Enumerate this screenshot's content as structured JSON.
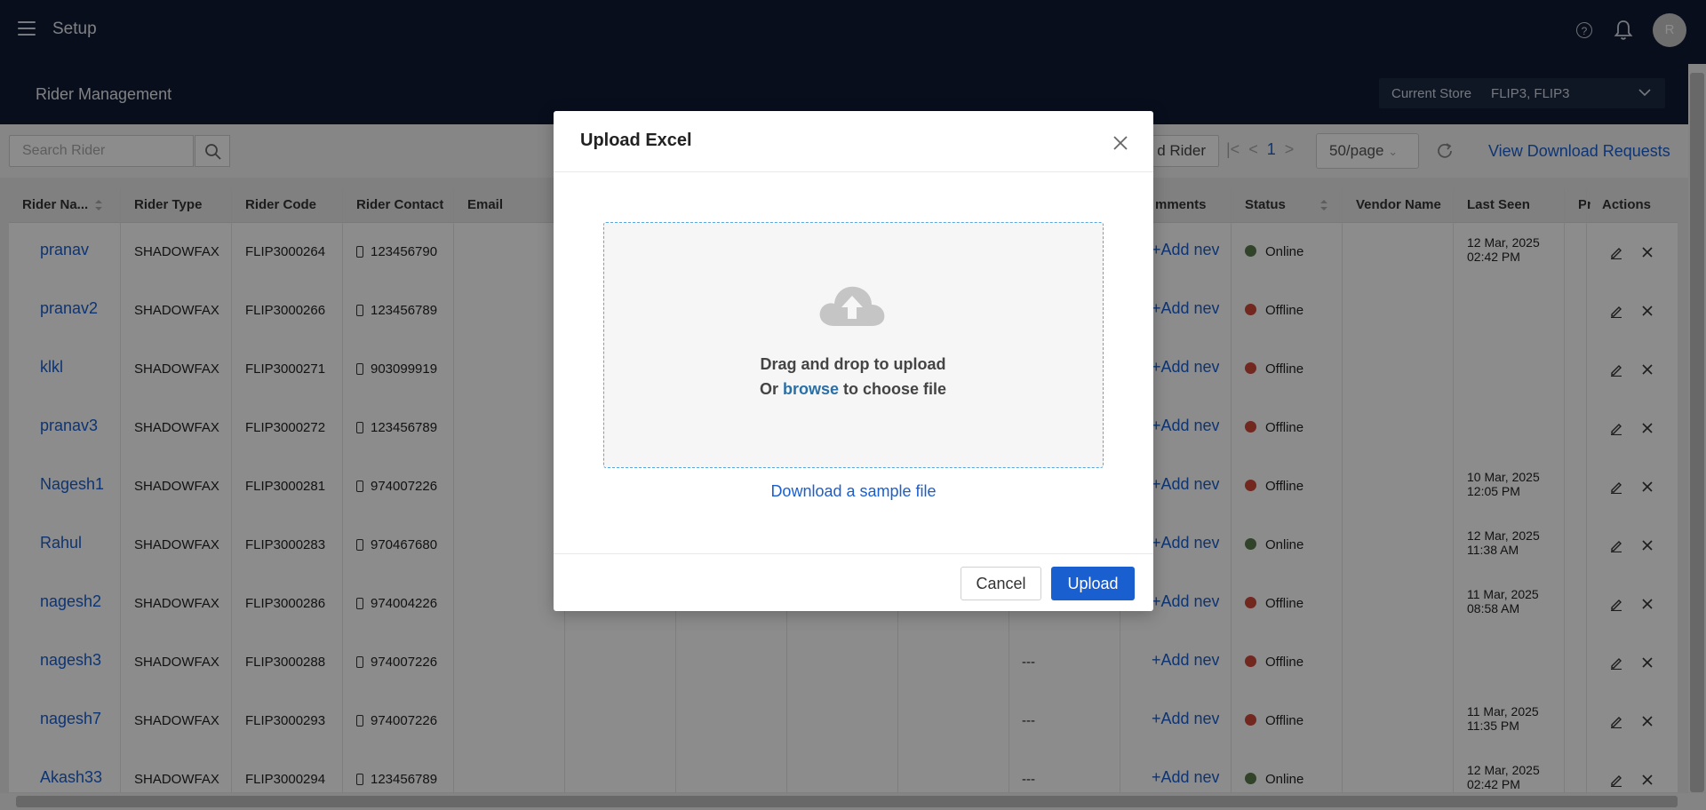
{
  "header": {
    "title": "Setup",
    "avatar_initial": "R",
    "help_glyph": "?"
  },
  "subheader": {
    "page_title": "Rider Management",
    "store_label": "Current Store",
    "store_value": "FLIP3, FLIP3"
  },
  "toolbar": {
    "search_placeholder": "Search Rider",
    "add_rider_label": "d Rider",
    "page_current": "1",
    "page_size": "50/page",
    "download_requests": "View Download Requests"
  },
  "table": {
    "columns": {
      "rider_name": "Rider Na...",
      "rider_type": "Rider Type",
      "rider_code": "Rider Code",
      "rider_contact": "Rider Contact",
      "email": "Email",
      "comments": "mments",
      "status": "Status",
      "vendor_name": "Vendor Name",
      "last_seen": "Last Seen",
      "pr": "Pr",
      "actions": "Actions"
    },
    "rows": [
      {
        "name": "pranav",
        "type": "SHADOWFAX",
        "code": "FLIP3000264",
        "contact": "123456790",
        "extra": "",
        "comment": "+Add nev",
        "status": "Online",
        "seen1": "12 Mar, 2025",
        "seen2": "02:42 PM"
      },
      {
        "name": "pranav2",
        "type": "SHADOWFAX",
        "code": "FLIP3000266",
        "contact": "123456789",
        "extra": "",
        "comment": "+Add nev",
        "status": "Offline",
        "seen1": "",
        "seen2": ""
      },
      {
        "name": "klkl",
        "type": "SHADOWFAX",
        "code": "FLIP3000271",
        "contact": "903099919",
        "extra": "",
        "comment": "+Add nev",
        "status": "Offline",
        "seen1": "",
        "seen2": ""
      },
      {
        "name": "pranav3",
        "type": "SHADOWFAX",
        "code": "FLIP3000272",
        "contact": "123456789",
        "extra": "",
        "comment": "+Add nev",
        "status": "Offline",
        "seen1": "",
        "seen2": ""
      },
      {
        "name": "Nagesh1",
        "type": "SHADOWFAX",
        "code": "FLIP3000281",
        "contact": "974007226",
        "extra": "",
        "comment": "+Add nev",
        "status": "Offline",
        "seen1": "10 Mar, 2025",
        "seen2": "12:05 PM"
      },
      {
        "name": "Rahul",
        "type": "SHADOWFAX",
        "code": "FLIP3000283",
        "contact": "970467680",
        "extra": "",
        "comment": "+Add nev",
        "status": "Online",
        "seen1": "12 Mar, 2025",
        "seen2": "11:38 AM"
      },
      {
        "name": "nagesh2",
        "type": "SHADOWFAX",
        "code": "FLIP3000286",
        "contact": "974004226",
        "extra": "",
        "comment": "+Add nev",
        "status": "Offline",
        "seen1": "11 Mar, 2025",
        "seen2": "08:58 AM"
      },
      {
        "name": "nagesh3",
        "type": "SHADOWFAX",
        "code": "FLIP3000288",
        "contact": "974007226",
        "extra": "---",
        "comment": "+Add nev",
        "status": "Offline",
        "seen1": "",
        "seen2": ""
      },
      {
        "name": "nagesh7",
        "type": "SHADOWFAX",
        "code": "FLIP3000293",
        "contact": "974007226",
        "extra": "---",
        "comment": "+Add nev",
        "status": "Offline",
        "seen1": "11 Mar, 2025",
        "seen2": "11:35 PM"
      },
      {
        "name": "Akash33",
        "type": "SHADOWFAX",
        "code": "FLIP3000294",
        "contact": "123456789",
        "extra": "---",
        "comment": "+Add nev",
        "status": "Online",
        "seen1": "12 Mar, 2025",
        "seen2": "02:42 PM"
      }
    ]
  },
  "colors": {
    "online": "#5a7a4a",
    "offline": "#d0473a",
    "accent": "#1a5fd0"
  },
  "modal": {
    "title": "Upload Excel",
    "drop_line1": "Drag and drop to upload",
    "drop_prefix": "Or ",
    "browse": "browse",
    "drop_suffix": " to choose file",
    "download_sample": "Download a sample file",
    "cancel": "Cancel",
    "upload": "Upload"
  }
}
